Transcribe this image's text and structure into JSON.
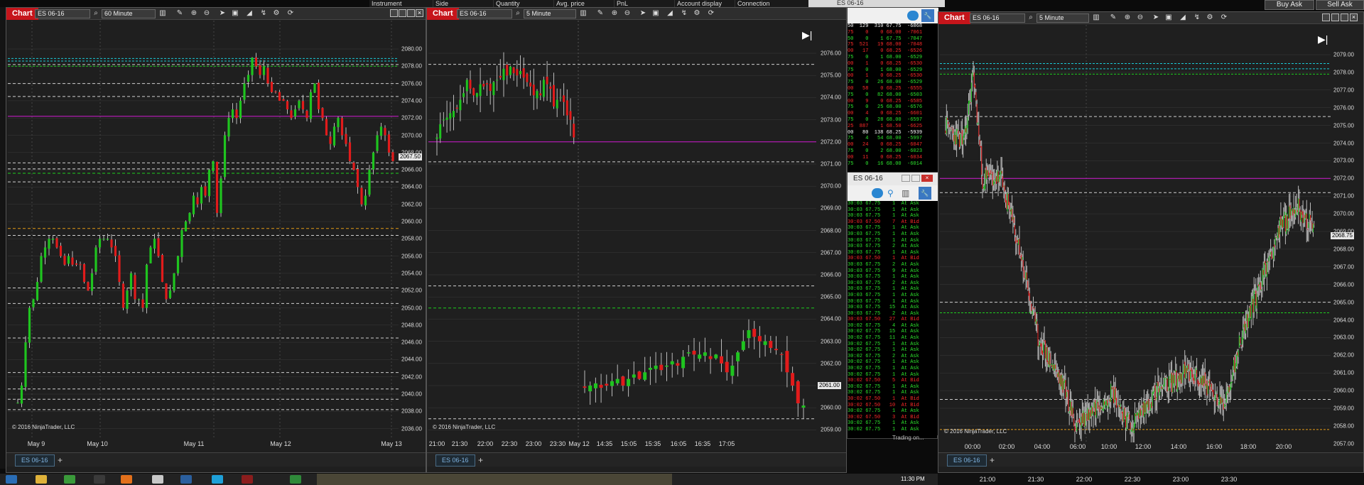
{
  "top_header": {
    "columns": [
      "Instrument",
      "Side",
      "Quantity",
      "Avg. price",
      "PnL",
      "Account display nam",
      "Connection"
    ]
  },
  "top_buttons": {
    "buy_ask": "Buy Ask",
    "sell_ask": "Sell Ask"
  },
  "colors": {
    "bull": "#1fc41f",
    "bear": "#e11b1b",
    "bg": "#1f1f1f",
    "grid": "#3a3a3a",
    "title_red": "#c6151b",
    "magenta": "#d11ad1",
    "green_line": "#1fcf1f",
    "orange_line": "#e39a17",
    "cyan_line": "#19c9d6"
  },
  "chart1": {
    "label": "Chart",
    "instrument": "ES 06-16",
    "interval": "60 Minute",
    "copyright": "© 2016 NinjaTrader, LLC",
    "price_tag": "2067.50",
    "tab_label": "ES 06-16",
    "tab_add": "+",
    "y_labels": [
      "2080.00",
      "2078.00",
      "2076.00",
      "2074.00",
      "2072.00",
      "2070.00",
      "2068.00",
      "2066.00",
      "2064.00",
      "2062.00",
      "2060.00",
      "2058.00",
      "2056.00",
      "2054.00",
      "2052.00",
      "2050.00",
      "2048.00",
      "2046.00",
      "2044.00",
      "2042.00",
      "2040.00",
      "2038.00",
      "2036.00"
    ],
    "x_labels": [
      "May 9",
      "May 10",
      "May 11",
      "May 12",
      "May 13"
    ]
  },
  "chart2": {
    "label": "Chart",
    "instrument": "ES 06-16",
    "interval": "5 Minute",
    "copyright": "© 2016 NinjaTrader, LLC",
    "price_tag": "2061.00",
    "tab_label": "ES 06-16",
    "tab_add": "+",
    "y_labels": [
      "2076.00",
      "2075.00",
      "2074.00",
      "2073.00",
      "2072.00",
      "2071.00",
      "2070.00",
      "2069.00",
      "2068.00",
      "2067.00",
      "2066.00",
      "2065.00",
      "2064.00",
      "2063.00",
      "2062.00",
      "2061.00",
      "2060.00",
      "2059.00"
    ],
    "x_labels": [
      "21:00",
      "21:30",
      "22:00",
      "22:30",
      "23:00",
      "23:30",
      "May 12",
      "14:35",
      "15:05",
      "15:35",
      "16:05",
      "16:35",
      "17:05"
    ]
  },
  "chart3": {
    "label": "Chart",
    "instrument": "ES 06-16",
    "interval": "5 Minute",
    "copyright": "© 2016 NinjaTrader, LLC",
    "price_tag": "2068.75",
    "tab_label": "ES 06-16",
    "tab_add": "+",
    "y_labels": [
      "2079.00",
      "2078.00",
      "2077.00",
      "2076.00",
      "2075.00",
      "2074.00",
      "2073.00",
      "2072.00",
      "2071.00",
      "2070.00",
      "2069.00",
      "2068.00",
      "2067.00",
      "2066.00",
      "2065.00",
      "2064.00",
      "2063.00",
      "2062.00",
      "2061.00",
      "2060.00",
      "2059.00",
      "2058.00",
      "2057.00"
    ],
    "x_labels": [
      "00:00",
      "02:00",
      "04:00",
      "06:00",
      "10:00",
      "12:00",
      "14:00",
      "16:00",
      "18:00",
      "20:00"
    ]
  },
  "ladder": {
    "title": "ES 06-16",
    "rows": [
      {
        "text": "50  129  310 67.75  -6868",
        "c": "w"
      },
      {
        "text": "75    0    0 68.00  -7061",
        "c": "r"
      },
      {
        "text": "50    0    1 67.75  -7047",
        "c": "g"
      },
      {
        "text": "75  521   19 68.00  -7048",
        "c": "r"
      },
      {
        "text": "00   17    0 68.25  -6526",
        "c": "r"
      },
      {
        "text": "75    0    1 68.00  -6529",
        "c": "g"
      },
      {
        "text": "00    1    0 68.25  -6530",
        "c": "r"
      },
      {
        "text": "75    0    1 68.00  -6529",
        "c": "g"
      },
      {
        "text": "00    1    0 68.25  -6530",
        "c": "r"
      },
      {
        "text": "75    0   26 68.00  -6529",
        "c": "g"
      },
      {
        "text": "00   58    0 68.25  -6555",
        "c": "r"
      },
      {
        "text": "75    0   82 68.00  -6503",
        "c": "g"
      },
      {
        "text": "00    9    0 68.25  -6585",
        "c": "r"
      },
      {
        "text": "75    0   25 68.00  -6576",
        "c": "g"
      },
      {
        "text": "00    4    0 68.25  -6601",
        "c": "r"
      },
      {
        "text": "75    0   28 68.00  -6597",
        "c": "g"
      },
      {
        "text": "25  887    1 68.50  -6625",
        "c": "r"
      },
      {
        "text": "00   80  138 68.25  -5939",
        "c": "w"
      },
      {
        "text": "75    4   54 68.00  -5997",
        "c": "g"
      },
      {
        "text": "00   24    0 68.25  -6047",
        "c": "r"
      },
      {
        "text": "75    0    2 68.00  -6023",
        "c": "g"
      },
      {
        "text": "00   11    0 68.25  -6034",
        "c": "r"
      },
      {
        "text": "75    0   16 68.00  -6014",
        "c": "g"
      }
    ]
  },
  "timesales": {
    "title": "ES 06-16",
    "footer": "Trading on...",
    "rows": [
      {
        "text": "30:03 67.75    1  At Ask",
        "c": "g"
      },
      {
        "text": "30:03 67.75    1  At Ask",
        "c": "g"
      },
      {
        "text": "30:03 67.75    1  At Ask",
        "c": "g"
      },
      {
        "text": "30:03 67.50    7  At Bid",
        "c": "r"
      },
      {
        "text": "30:03 67.75    1  At Ask",
        "c": "g"
      },
      {
        "text": "30:03 67.75    1  At Ask",
        "c": "g"
      },
      {
        "text": "30:03 67.75    1  At Ask",
        "c": "g"
      },
      {
        "text": "30:03 67.75    2  At Ask",
        "c": "g"
      },
      {
        "text": "30:03 67.75    1  At Ask",
        "c": "g"
      },
      {
        "text": "30:03 67.50    1  At Bid",
        "c": "r"
      },
      {
        "text": "30:03 67.75    2  At Ask",
        "c": "g"
      },
      {
        "text": "30:03 67.75    9  At Ask",
        "c": "g"
      },
      {
        "text": "30:03 67.75    1  At Ask",
        "c": "g"
      },
      {
        "text": "30:03 67.75    2  At Ask",
        "c": "g"
      },
      {
        "text": "30:03 67.75    1  At Ask",
        "c": "g"
      },
      {
        "text": "30:03 67.75    1  At Ask",
        "c": "g"
      },
      {
        "text": "30:03 67.75    1  At Ask",
        "c": "g"
      },
      {
        "text": "30:03 67.75   15  At Ask",
        "c": "g"
      },
      {
        "text": "30:03 67.75    2  At Ask",
        "c": "g"
      },
      {
        "text": "30:03 67.50   27  At Bid",
        "c": "r"
      },
      {
        "text": "30:02 67.75    4  At Ask",
        "c": "g"
      },
      {
        "text": "30:02 67.75   15  At Ask",
        "c": "g"
      },
      {
        "text": "30:02 67.75   11  At Ask",
        "c": "g"
      },
      {
        "text": "30:02 67.75    1  At Ask",
        "c": "g"
      },
      {
        "text": "30:02 67.75    1  At Ask",
        "c": "g"
      },
      {
        "text": "30:02 67.75    2  At Ask",
        "c": "g"
      },
      {
        "text": "30:02 67.75    1  At Ask",
        "c": "g"
      },
      {
        "text": "30:02 67.75    1  At Ask",
        "c": "g"
      },
      {
        "text": "30:02 67.75    1  At Ask",
        "c": "g"
      },
      {
        "text": "30:02 67.50    5  At Bid",
        "c": "r"
      },
      {
        "text": "30:02 67.75    1  At Ask",
        "c": "g"
      },
      {
        "text": "30:02 67.75    1  At Ask",
        "c": "g"
      },
      {
        "text": "30:02 67.50    1  At Bid",
        "c": "r"
      },
      {
        "text": "30:02 67.50   10  At Bid",
        "c": "r"
      },
      {
        "text": "30:02 67.75    1  At Ask",
        "c": "g"
      },
      {
        "text": "30:02 67.50    3  At Bid",
        "c": "r"
      },
      {
        "text": "30:02 67.75    1  At Ask",
        "c": "g"
      },
      {
        "text": "30:02 67.75    1  At Ask",
        "c": "g"
      }
    ]
  },
  "small_top_title": "ES 06-16",
  "taskbar": {
    "clock": "11:30 PM",
    "bottom_times": [
      "21:00",
      "21:30",
      "22:00",
      "22:30",
      "23:00",
      "23:30"
    ]
  }
}
